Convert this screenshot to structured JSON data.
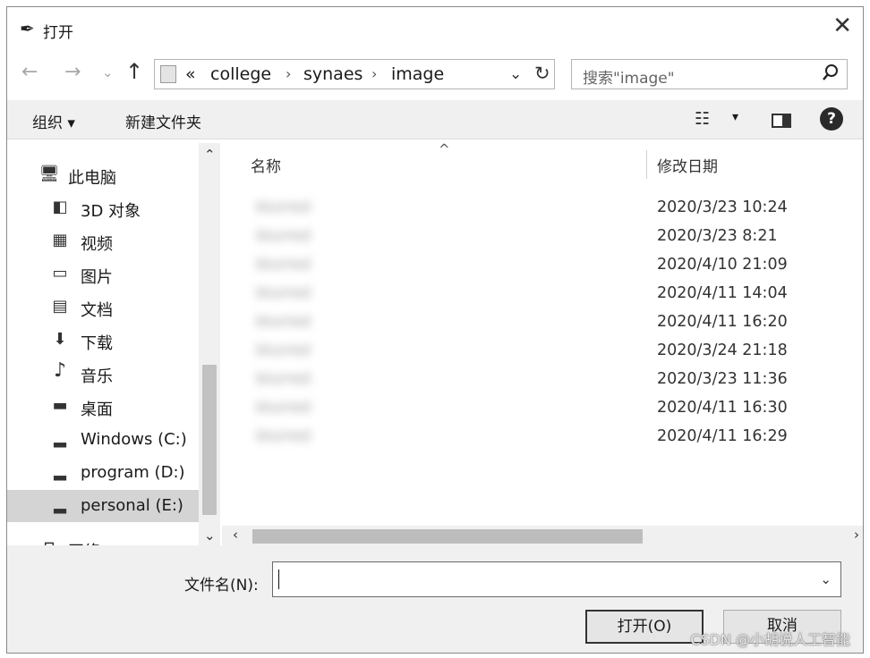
{
  "window": {
    "title": "打开",
    "app_icon": "feather-icon",
    "close": "✕"
  },
  "navigation": {
    "back": "←",
    "forward": "→",
    "recent": "⌄",
    "up": "↑",
    "breadcrumb_overflow": "«",
    "breadcrumbs": [
      "college",
      "synaes",
      "image"
    ],
    "separator": "›",
    "dropdown": "⌄",
    "refresh": "↻",
    "search_placeholder": "搜索\"image\""
  },
  "toolbar": {
    "organize_label": "组织 ▾",
    "new_folder_label": "新建文件夹",
    "view_icon": "☷",
    "view_dropdown": "▾",
    "help": "?"
  },
  "sidebar": {
    "items": [
      {
        "label": "此电脑",
        "icon": "computer-icon",
        "glyph": "🖥"
      },
      {
        "label": "3D 对象",
        "icon": "cube-icon",
        "glyph": "◧"
      },
      {
        "label": "视频",
        "icon": "video-icon",
        "glyph": "▦"
      },
      {
        "label": "图片",
        "icon": "picture-icon",
        "glyph": "▭"
      },
      {
        "label": "文档",
        "icon": "document-icon",
        "glyph": "▤"
      },
      {
        "label": "下载",
        "icon": "download-icon",
        "glyph": "⬇"
      },
      {
        "label": "音乐",
        "icon": "music-icon",
        "glyph": "♪"
      },
      {
        "label": "桌面",
        "icon": "desktop-icon",
        "glyph": "▬"
      },
      {
        "label": "Windows (C:)",
        "icon": "windows-drive-icon",
        "glyph": "▂"
      },
      {
        "label": "program (D:)",
        "icon": "drive-icon",
        "glyph": "▂"
      },
      {
        "label": "personal (E:)",
        "icon": "drive-icon",
        "glyph": "▂",
        "selected": true
      },
      {
        "label": "网络",
        "icon": "network-icon",
        "glyph": "⊓"
      }
    ],
    "scroll_up": "⌃",
    "scroll_down": "⌄"
  },
  "file_list": {
    "columns": {
      "name": "名称",
      "date": "修改日期",
      "sort_indicator": "^"
    },
    "rows": [
      {
        "name": "blurred",
        "date": "2020/3/23 10:24"
      },
      {
        "name": "blurred",
        "date": "2020/3/23 8:21"
      },
      {
        "name": "blurred",
        "date": "2020/4/10 21:09"
      },
      {
        "name": "blurred",
        "date": "2020/4/11 14:04"
      },
      {
        "name": "blurred",
        "date": "2020/4/11 16:20"
      },
      {
        "name": "blurred",
        "date": "2020/3/24 21:18"
      },
      {
        "name": "blurred",
        "date": "2020/3/23 11:36"
      },
      {
        "name": "blurred",
        "date": "2020/4/11 16:30"
      },
      {
        "name": "blurred",
        "date": "2020/4/11 16:29"
      }
    ],
    "scroll_left": "‹",
    "scroll_right": "›"
  },
  "footer": {
    "filename_label": "文件名(N):",
    "filename_value": "",
    "dropdown": "⌄",
    "open_button": "打开(O)",
    "cancel_button": "取消",
    "watermark": "CSDN @小胡说人工智能"
  }
}
